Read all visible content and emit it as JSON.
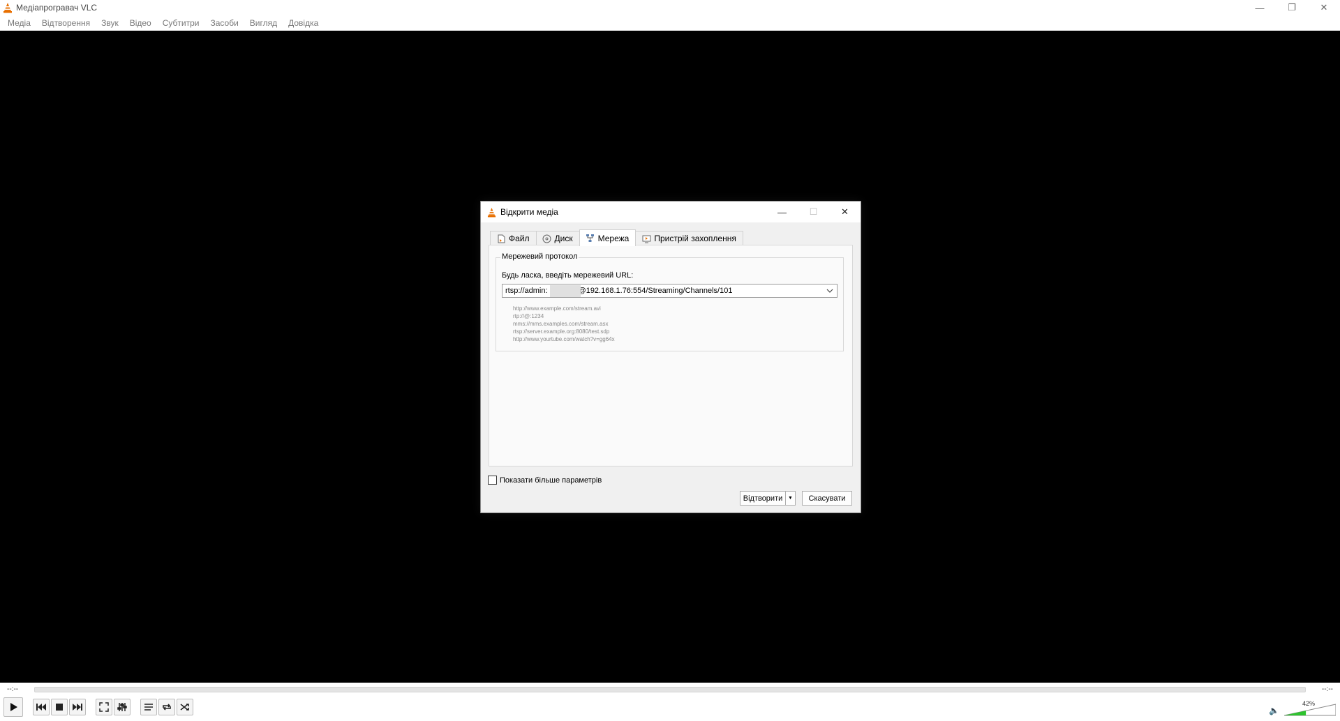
{
  "window": {
    "title": "Медіапрогравач VLC"
  },
  "menu": {
    "items": [
      "Медіа",
      "Відтворення",
      "Звук",
      "Відео",
      "Субтитри",
      "Засоби",
      "Вигляд",
      "Довідка"
    ]
  },
  "player": {
    "time_elapsed": "--:--",
    "time_total": "--:--",
    "volume_label": "42%",
    "volume_level": 42
  },
  "dialog": {
    "title": "Відкрити медіа",
    "tabs": [
      {
        "label": "Файл",
        "icon": "file-icon"
      },
      {
        "label": "Диск",
        "icon": "disc-icon"
      },
      {
        "label": "Мережа",
        "icon": "network-icon",
        "active": true
      },
      {
        "label": "Пристрій захоплення",
        "icon": "capture-device-icon"
      }
    ],
    "group_title": "Мережевий протокол",
    "url_prompt": "Будь ласка, введіть мережевий URL:",
    "url_prefix": "rtsp://admin:",
    "url_suffix": "@192.168.1.76:554/Streaming/Channels/101",
    "examples": [
      "http://www.example.com/stream.avi",
      "rtp://@:1234",
      "mms://mms.examples.com/stream.asx",
      "rtsp://server.example.org:8080/test.sdp",
      "http://www.yourtube.com/watch?v=gg64x"
    ],
    "show_more_label": "Показати більше параметрів",
    "play_button": "Відтворити",
    "cancel_button": "Скасувати"
  },
  "colors": {
    "vlc_orange": "#e86f00",
    "video_bg": "#000000",
    "volume_green": "#2ec32e"
  }
}
